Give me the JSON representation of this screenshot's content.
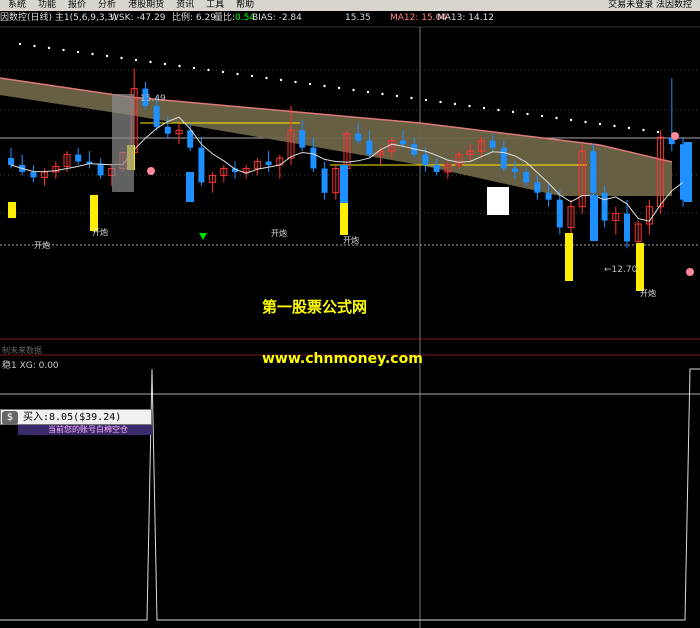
{
  "menu": {
    "items": [
      "系统",
      "功能",
      "报价",
      "分析",
      "港股期货",
      "资讯",
      "工具",
      "帮助"
    ],
    "status": "交易未登录  法因数控"
  },
  "info": {
    "title": "因数控(日线) 主1(5,6,9,3,3)",
    "wsk": "WSK: -47.29",
    "ratio": "比例: 6.29",
    "volratio_label": "量比:",
    "volratio_value": "0.54",
    "bias": "BIAS: -2.84",
    "val": "15.35",
    "ma12": "MA12: 15.04",
    "ma13": "MA13: 14.12"
  },
  "chart": {
    "high_label": "15.49",
    "low_label": "←12.70",
    "signals": [
      "开炮",
      "开炮",
      "开炮",
      "开炮",
      "开炮"
    ]
  },
  "watermark": {
    "line1": "第一股票公式网",
    "line2": "www.chnmoney.com"
  },
  "sub_panel": {
    "note": "制未来数据",
    "label": "稳1  XG: 0.00"
  },
  "trade": {
    "icon": "$",
    "text": "买入:8.05($39.24) -0.00",
    "hint": "当前您的账号白棉空仓"
  },
  "colors": {
    "background": "#000000",
    "up_candle": "#ff3333",
    "down_candle": "#1e90ff",
    "highlight": "#ffee00",
    "band": "#6b6448",
    "ma_line": "#e07a7a"
  },
  "chart_data": {
    "type": "candlestick",
    "ohlc": [
      [
        14.2,
        14.35,
        14.05,
        14.1
      ],
      [
        14.1,
        14.25,
        13.95,
        14.0
      ],
      [
        14.0,
        14.1,
        13.85,
        13.92
      ],
      [
        13.92,
        14.05,
        13.8,
        14.0
      ],
      [
        14.0,
        14.15,
        13.9,
        14.08
      ],
      [
        14.08,
        14.3,
        14.0,
        14.25
      ],
      [
        14.25,
        14.35,
        14.1,
        14.15
      ],
      [
        14.15,
        14.3,
        14.05,
        14.12
      ],
      [
        14.12,
        14.2,
        13.9,
        13.95
      ],
      [
        13.95,
        14.1,
        13.8,
        14.05
      ],
      [
        14.05,
        14.3,
        14.0,
        14.28
      ],
      [
        14.28,
        15.49,
        14.2,
        15.2
      ],
      [
        15.2,
        15.3,
        14.9,
        14.95
      ],
      [
        14.95,
        15.1,
        14.6,
        14.65
      ],
      [
        14.65,
        14.8,
        14.5,
        14.55
      ],
      [
        14.55,
        14.7,
        14.4,
        14.6
      ],
      [
        14.6,
        14.7,
        14.3,
        14.35
      ],
      [
        14.35,
        14.5,
        13.8,
        13.85
      ],
      [
        13.85,
        14.0,
        13.7,
        13.95
      ],
      [
        13.95,
        14.1,
        13.85,
        14.05
      ],
      [
        14.05,
        14.15,
        13.9,
        14.0
      ],
      [
        14.0,
        14.1,
        13.9,
        14.05
      ],
      [
        14.05,
        14.2,
        13.95,
        14.15
      ],
      [
        14.15,
        14.3,
        14.0,
        14.1
      ],
      [
        14.1,
        14.25,
        13.9,
        14.2
      ],
      [
        14.2,
        14.95,
        14.1,
        14.6
      ],
      [
        14.6,
        14.75,
        14.3,
        14.35
      ],
      [
        14.35,
        14.5,
        14.0,
        14.05
      ],
      [
        14.05,
        14.15,
        13.6,
        13.7
      ],
      [
        13.7,
        14.1,
        13.6,
        14.05
      ],
      [
        14.05,
        14.6,
        14.0,
        14.55
      ],
      [
        14.55,
        14.7,
        14.4,
        14.45
      ],
      [
        14.45,
        14.6,
        14.2,
        14.25
      ],
      [
        14.25,
        14.35,
        14.1,
        14.3
      ],
      [
        14.3,
        14.5,
        14.2,
        14.45
      ],
      [
        14.45,
        14.6,
        14.35,
        14.4
      ],
      [
        14.4,
        14.5,
        14.2,
        14.25
      ],
      [
        14.25,
        14.35,
        14.0,
        14.1
      ],
      [
        14.1,
        14.2,
        13.95,
        14.0
      ],
      [
        14.0,
        14.15,
        13.9,
        14.1
      ],
      [
        14.1,
        14.3,
        14.05,
        14.25
      ],
      [
        14.25,
        14.4,
        14.15,
        14.3
      ],
      [
        14.3,
        14.5,
        14.2,
        14.45
      ],
      [
        14.45,
        14.55,
        14.3,
        14.35
      ],
      [
        14.35,
        14.45,
        14.0,
        14.05
      ],
      [
        14.05,
        14.15,
        13.9,
        14.0
      ],
      [
        14.0,
        14.05,
        13.8,
        13.85
      ],
      [
        13.85,
        13.95,
        13.6,
        13.7
      ],
      [
        13.7,
        13.85,
        13.5,
        13.6
      ],
      [
        13.6,
        13.75,
        13.1,
        13.2
      ],
      [
        13.2,
        13.6,
        13.1,
        13.5
      ],
      [
        13.5,
        14.4,
        13.4,
        14.3
      ],
      [
        14.3,
        14.4,
        13.6,
        13.7
      ],
      [
        13.7,
        13.8,
        13.2,
        13.3
      ],
      [
        13.3,
        13.5,
        13.1,
        13.4
      ],
      [
        13.4,
        13.6,
        12.9,
        13.0
      ],
      [
        13.0,
        13.3,
        12.7,
        13.25
      ],
      [
        13.25,
        13.6,
        13.1,
        13.5
      ],
      [
        13.5,
        14.6,
        13.4,
        14.5
      ],
      [
        14.5,
        15.35,
        14.3,
        14.4
      ],
      [
        14.4,
        14.5,
        13.5,
        13.6
      ]
    ]
  }
}
